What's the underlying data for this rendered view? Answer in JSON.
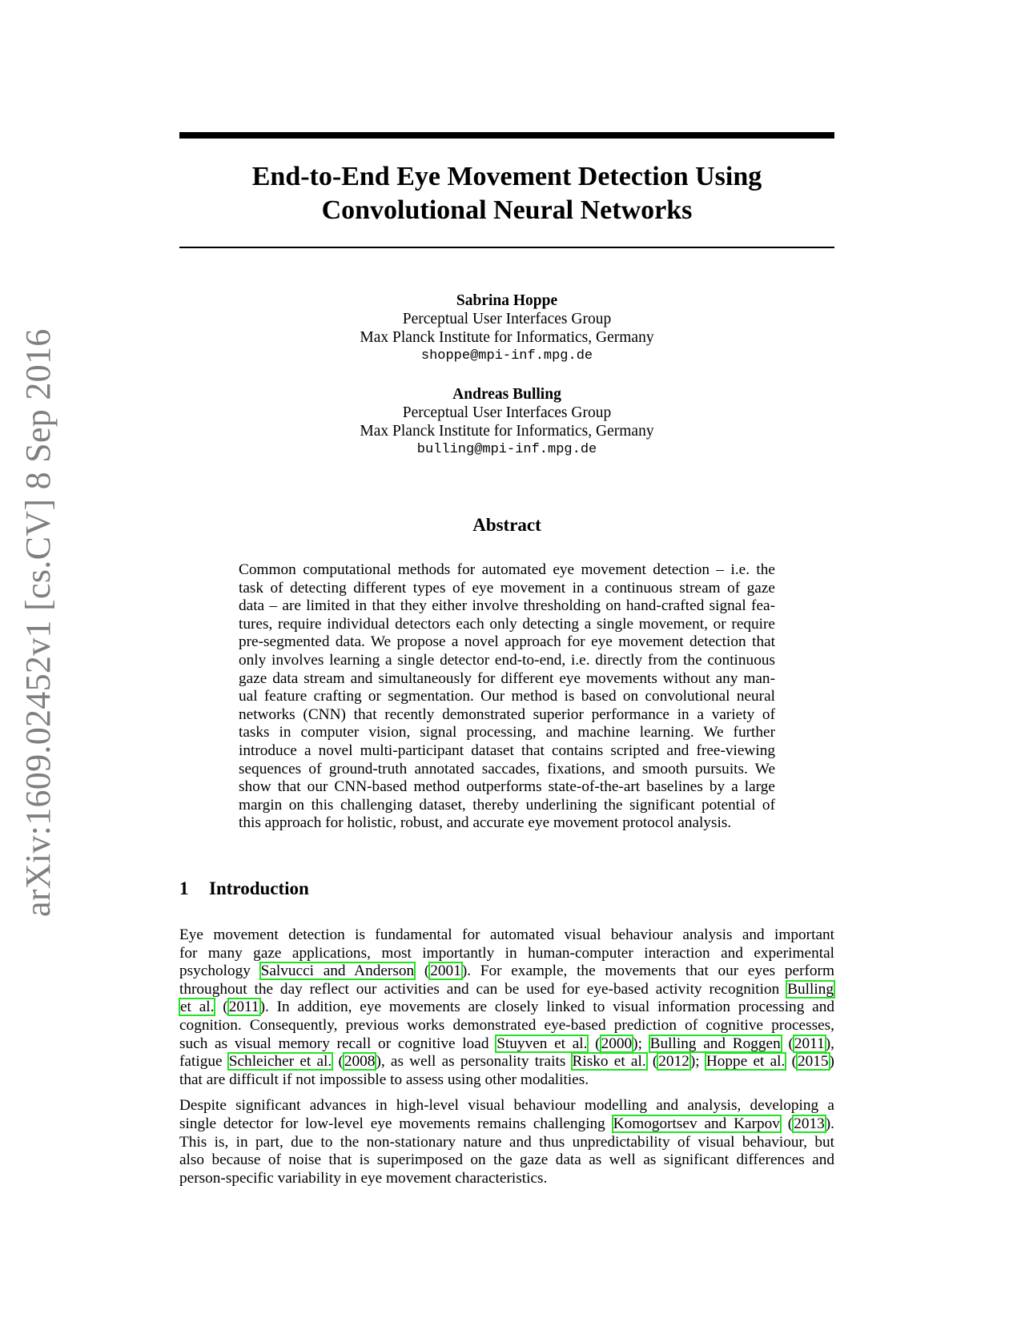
{
  "side_stamp": "arXiv:1609.02452v1  [cs.CV]  8 Sep 2016",
  "title_lines": [
    "End-to-End Eye Movement Detection Using",
    "Convolutional Neural Networks"
  ],
  "authors": [
    {
      "name": "Sabrina Hoppe",
      "group": "Perceptual User Interfaces Group",
      "institute": "Max Planck Institute for Informatics, Germany",
      "email": "shoppe@mpi-inf.mpg.de"
    },
    {
      "name": "Andreas Bulling",
      "group": "Perceptual User Interfaces Group",
      "institute": "Max Planck Institute for Informatics, Germany",
      "email": "bulling@mpi-inf.mpg.de"
    }
  ],
  "abstract": {
    "heading": "Abstract",
    "lines": [
      "Common computational methods for automated eye movement detection – i.e. the",
      "task of detecting different types of eye movement in a continuous stream of gaze",
      "data – are limited in that they either involve thresholding on hand-crafted signal fea-",
      "tures, require individual detectors each only detecting a single movement, or require",
      "pre-segmented data. We propose a novel approach for eye movement detection that",
      "only involves learning a single detector end-to-end, i.e. directly from the continuous",
      "gaze data stream and simultaneously for different eye movements without any man-",
      "ual feature crafting or segmentation. Our method is based on convolutional neural",
      "networks (CNN) that recently demonstrated superior performance in a variety of",
      "tasks in computer vision, signal processing, and machine learning. We further",
      "introduce a novel multi-participant dataset that contains scripted and free-viewing",
      "sequences of ground-truth annotated saccades, fixations, and smooth pursuits. We",
      "show that our CNN-based method outperforms state-of-the-art baselines by a large",
      "margin on this challenging dataset, thereby underlining the significant potential of",
      "this approach for holistic, robust, and accurate eye movement protocol analysis."
    ]
  },
  "section": {
    "number": "1",
    "title": "Introduction"
  },
  "intro_p1": {
    "l1": "Eye movement detection is fundamental for automated visual behaviour analysis and important",
    "l2": "for many gaze applications, most importantly in human-computer interaction and experimental",
    "l3a": "psychology ",
    "c1": "Salvucci and Anderson",
    "l3b": " (",
    "y1": "2001",
    "l3c": ").  For example, the movements that our eyes perform",
    "l4a": "throughout the day reflect our activities and can be used for eye-based activity recognition ",
    "c2a": "Bulling",
    "c2b": "et al.",
    "l5a": " (",
    "y2": "2011",
    "l5b": ").  In addition, eye movements are closely linked to visual information processing and",
    "l6": "cognition. Consequently, previous works demonstrated eye-based prediction of cognitive processes,",
    "l7a": "such as visual memory recall or cognitive load ",
    "c3": "Stuyven et al.",
    "l7b": " (",
    "y3": "2000",
    "l7c": "); ",
    "c4": "Bulling and Roggen",
    "l7d": " (",
    "y4": "2011",
    "l7e": "),",
    "l8a": "fatigue ",
    "c5": "Schleicher et al.",
    "l8b": " (",
    "y5": "2008",
    "l8c": "), as well as personality traits ",
    "c6": "Risko et al.",
    "l8d": " (",
    "y6": "2012",
    "l8e": "); ",
    "c7": "Hoppe et al.",
    "l8f": " (",
    "y7": "2015",
    "l8g": ")",
    "l9": "that are difficult if not impossible to assess using other modalities."
  },
  "intro_p2": {
    "l1": "Despite significant advances in high-level visual behaviour modelling and analysis, developing a",
    "l2a": "single detector for low-level eye movements remains challenging ",
    "c1": "Komogortsev and Karpov",
    "l2b": " (",
    "y1": "2013",
    "l2c": ").",
    "l3": "This is, in part, due to the non-stationary nature and thus unpredictability of visual behaviour, but",
    "l4": "also because of noise that is superimposed on the gaze data as well as significant differences and",
    "l5": "person-specific variability in eye movement characteristics."
  },
  "citation_box_color": "#22e322"
}
